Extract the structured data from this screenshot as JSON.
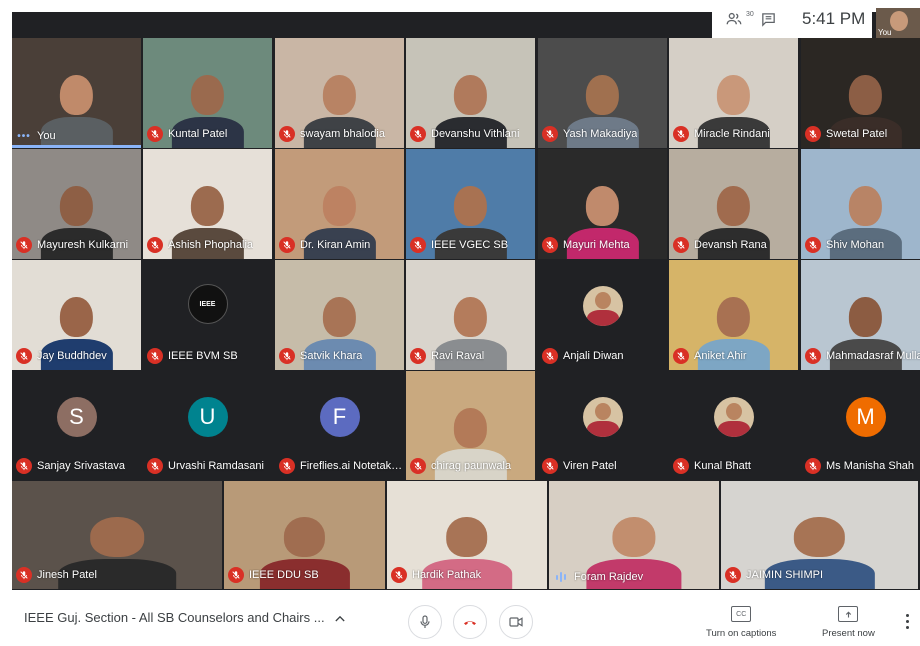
{
  "top_bar": {
    "participant_count_badge": "30",
    "time": "5:41 PM",
    "self_view_label": "You"
  },
  "participants": [
    {
      "name": "You",
      "muted": false,
      "indicator": "dots",
      "type": "video",
      "bg": "#4a3f38",
      "skin": "#c08a6a",
      "shirt": "#5a5f62",
      "active": true
    },
    {
      "name": "Kuntal Patel",
      "muted": true,
      "type": "video",
      "bg": "#6d8a7c",
      "skin": "#9a6a4e",
      "shirt": "#2c3446"
    },
    {
      "name": "swayam bhalodia",
      "muted": true,
      "type": "video",
      "bg": "#c9b6a5",
      "skin": "#b88364",
      "shirt": "#3f4246"
    },
    {
      "name": "Devanshu Vithlani",
      "muted": true,
      "type": "video",
      "bg": "#c6c3b8",
      "skin": "#b07a5c",
      "shirt": "#2a2c30"
    },
    {
      "name": "Yash Makadiya",
      "muted": true,
      "type": "video",
      "bg": "#4c4c4c",
      "skin": "#a0704f",
      "shirt": "#6e7a88"
    },
    {
      "name": "Miracle Rindani",
      "muted": true,
      "type": "video",
      "bg": "#d5cfc6",
      "skin": "#c9987a",
      "shirt": "#3a3a3a"
    },
    {
      "name": "Swetal Patel",
      "muted": true,
      "type": "video",
      "bg": "#2b2723",
      "skin": "#8c5e45",
      "shirt": "#3a2d28"
    },
    {
      "name": "Mayuresh Kulkarni",
      "muted": true,
      "type": "video",
      "bg": "#8f8a86",
      "skin": "#8e5f45",
      "shirt": "#2b2b2b"
    },
    {
      "name": "Ashish Phophalia",
      "muted": true,
      "type": "video",
      "bg": "#e6e0d8",
      "skin": "#9c6b4f",
      "shirt": "#5a4a3e"
    },
    {
      "name": "Dr. Kiran Amin",
      "muted": true,
      "type": "video",
      "bg": "#c29b7a",
      "skin": "#bd8262",
      "shirt": "#394150"
    },
    {
      "name": "IEEE VGEC SB",
      "muted": true,
      "type": "video",
      "bg": "#4f7ca8",
      "skin": "#a87252",
      "shirt": "#3a3a3a"
    },
    {
      "name": "Mayuri Mehta",
      "muted": true,
      "type": "video",
      "bg": "#2a2a2a",
      "skin": "#c08a6c",
      "shirt": "#c2286b"
    },
    {
      "name": "Devansh Rana",
      "muted": true,
      "type": "video",
      "bg": "#b7ad9f",
      "skin": "#a06b4e",
      "shirt": "#2d2d2d"
    },
    {
      "name": "Shiv Mohan",
      "muted": true,
      "type": "video",
      "bg": "#9eb6cc",
      "skin": "#b88466",
      "shirt": "#5b6d7e"
    },
    {
      "name": "Jay Buddhdev",
      "muted": true,
      "type": "video",
      "bg": "#e2ddd5",
      "skin": "#9a6549",
      "shirt": "#1f3d6e"
    },
    {
      "name": "IEEE BVM SB",
      "muted": true,
      "type": "logo",
      "logo_text": "IEEE"
    },
    {
      "name": "Satvik Khara",
      "muted": true,
      "type": "video",
      "bg": "#c6bca9",
      "skin": "#a87456",
      "shirt": "#6c8bb0"
    },
    {
      "name": "Ravi Raval",
      "muted": true,
      "type": "video",
      "bg": "#d9d4cc",
      "skin": "#b47c5c",
      "shirt": "#8a8d90"
    },
    {
      "name": "Anjali Diwan",
      "muted": true,
      "type": "round-photo"
    },
    {
      "name": "Aniket Ahir",
      "muted": true,
      "type": "video",
      "bg": "#d6b468",
      "skin": "#a87152",
      "shirt": "#7da6c4"
    },
    {
      "name": "Mahmadasraf Mulla",
      "muted": true,
      "type": "video",
      "bg": "#b9c6d1",
      "skin": "#8c5c42",
      "shirt": "#4a4a4a"
    },
    {
      "name": "Sanjay Srivastava",
      "muted": true,
      "type": "avatar",
      "initial": "S",
      "color": "#8d6e63"
    },
    {
      "name": "Urvashi Ramdasani",
      "muted": true,
      "type": "avatar",
      "initial": "U",
      "color": "#00838f"
    },
    {
      "name": "Fireflies.ai Notetaker M...",
      "muted": true,
      "type": "avatar",
      "initial": "F",
      "color": "#5c6bc0"
    },
    {
      "name": "chirag paunwala",
      "muted": true,
      "type": "video",
      "bg": "#c9a97f",
      "skin": "#b37a58",
      "shirt": "#d8d4c8"
    },
    {
      "name": "Viren Patel",
      "muted": true,
      "type": "round-photo"
    },
    {
      "name": "Kunal Bhatt",
      "muted": true,
      "type": "round-photo"
    },
    {
      "name": "Ms Manisha Shah",
      "muted": true,
      "type": "avatar",
      "initial": "M",
      "color": "#ef6c00"
    },
    {
      "name": "Jinesh Patel",
      "muted": true,
      "type": "video",
      "bg": "#5b524b",
      "skin": "#9c6a4d",
      "shirt": "#2a2a2a"
    },
    {
      "name": "IEEE DDU SB",
      "muted": true,
      "type": "video",
      "bg": "#b89a78",
      "skin": "#a06d50",
      "shirt": "#8a2e2e"
    },
    {
      "name": "Hardik Pathak",
      "muted": true,
      "type": "video",
      "bg": "#e6e0d6",
      "skin": "#a87456",
      "shirt": "#d36b85"
    },
    {
      "name": "Foram Rajdev",
      "muted": false,
      "indicator": "wave",
      "type": "video",
      "bg": "#d7cfc4",
      "skin": "#c28e6e",
      "shirt": "#c23a6a"
    },
    {
      "name": "JAIMIN SHIMPI",
      "muted": true,
      "type": "video",
      "bg": "#d6d4d0",
      "skin": "#a77455",
      "shirt": "#3b5a86"
    }
  ],
  "bottom_bar": {
    "meeting_title": "IEEE Guj. Section - All SB Counselors and Chairs ...",
    "caret": "^",
    "captions_label": "Turn on captions",
    "captions_icon_text": "CC",
    "present_label": "Present now"
  },
  "colors": {
    "grid_bg": "#202124",
    "muted_red": "#d93025",
    "accent_blue": "#8ab4f8"
  }
}
